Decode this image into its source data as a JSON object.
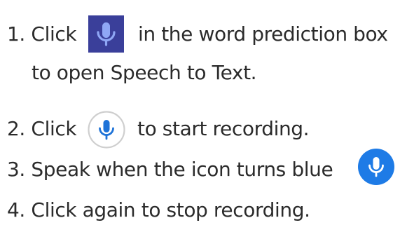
{
  "steps": [
    {
      "prefix": "1. Click",
      "suffix": "in the word prediction box",
      "continuation": "to open Speech to Text.",
      "icon": "microphone-icon"
    },
    {
      "prefix": "2. Click",
      "suffix": "to start recording.",
      "icon": "microphone-icon"
    },
    {
      "text": "3. Speak when the icon turns blue",
      "icon": "microphone-icon"
    },
    {
      "text": "4. Click again to stop recording."
    }
  ],
  "colors": {
    "text": "#2b2b2b",
    "prediction_box_button": "#3a3f9a",
    "prediction_box_mic": "#8fa7f5",
    "record_button_border": "#cfcfcf",
    "record_button_mic": "#1e73d8",
    "recording_button": "#1e7be6",
    "recording_mic": "#ffffff"
  }
}
